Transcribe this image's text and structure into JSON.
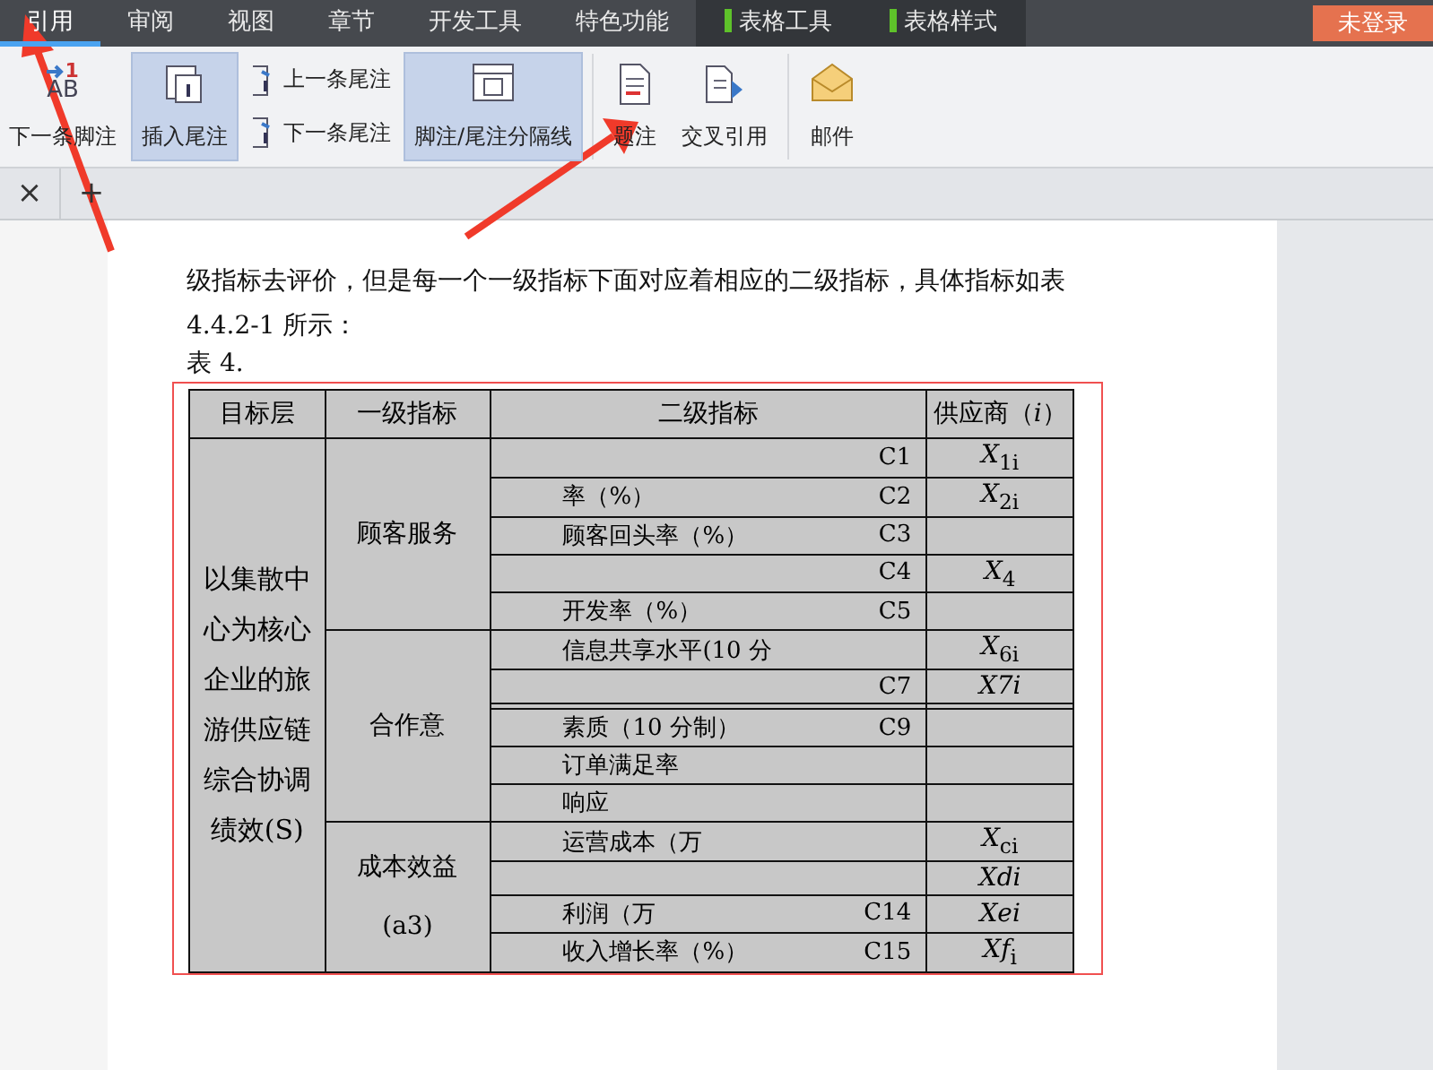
{
  "menu_tabs": [
    {
      "label": "引用",
      "selected": true,
      "kind": "normal"
    },
    {
      "label": "审阅",
      "selected": false,
      "kind": "normal"
    },
    {
      "label": "视图",
      "selected": false,
      "kind": "normal"
    },
    {
      "label": "章节",
      "selected": false,
      "kind": "normal"
    },
    {
      "label": "开发工具",
      "selected": false,
      "kind": "normal"
    },
    {
      "label": "特色功能",
      "selected": false,
      "kind": "normal"
    },
    {
      "label": "表格工具",
      "selected": false,
      "kind": "context"
    },
    {
      "label": "表格样式",
      "selected": false,
      "kind": "context"
    }
  ],
  "login_button": "未登录",
  "ribbon": [
    {
      "label": "下一条脚注",
      "kind": "large",
      "highlighted": false,
      "icon_text": {
        "badge": "1",
        "main": "AB"
      }
    },
    {
      "label": "插入尾注",
      "kind": "large",
      "highlighted": true
    },
    {
      "label": "上一条尾注",
      "kind": "small",
      "highlighted": false
    },
    {
      "label": "下一条尾注",
      "kind": "small",
      "highlighted": false
    },
    {
      "label": "脚注/尾注分隔线",
      "kind": "large",
      "highlighted": true
    },
    {
      "label": "题注",
      "kind": "large",
      "highlighted": false
    },
    {
      "label": "交叉引用",
      "kind": "large",
      "highlighted": false
    },
    {
      "label": "邮件",
      "kind": "large",
      "highlighted": false
    }
  ],
  "doc_tabs": {
    "close": "×",
    "add": "+"
  },
  "document": {
    "lines": [
      "级指标去评价，但是每一个一级指标下面对应着相应的二级指标，具体指标如表",
      "4.4.2-1 所示："
    ],
    "caption": "表 4."
  },
  "table": {
    "columns": [
      "目标层",
      "一级指标",
      "二级指标",
      "供应商（*i*）"
    ],
    "goal": "以集散中心为核心企业的旅游供应链综合协调绩效(S)",
    "groups": [
      {
        "name": "顾客服务",
        "rows": [
          {
            "indicator": "",
            "code": "C1",
            "supplier": "*X*$_{1i}$"
          },
          {
            "indicator": "率（%）",
            "code": "C2",
            "supplier": "*X*$_{2i}$"
          },
          {
            "indicator": "顾客回头率（%）",
            "code": "C3",
            "supplier": ""
          },
          {
            "indicator": "",
            "code": "C4",
            "supplier": "*X*$_{4}$"
          },
          {
            "indicator": "开发率（%）",
            "code": "C5",
            "supplier": ""
          }
        ]
      },
      {
        "name": "合作意",
        "rows": [
          {
            "indicator": "信息共享水平(10 分",
            "code": "",
            "supplier": "*X*$_{6i}$"
          },
          {
            "indicator": "",
            "code": "C7",
            "supplier": "*X7i*"
          },
          {
            "indicator": "",
            "code": "",
            "supplier": ""
          },
          {
            "indicator": "素质（10 分制）",
            "code": "C9",
            "supplier": ""
          },
          {
            "indicator": "订单满足率",
            "code": "",
            "supplier": ""
          },
          {
            "indicator": "响应",
            "code": "",
            "supplier": ""
          }
        ]
      },
      {
        "name": "成本效益",
        "sub": "(a3)",
        "rows": [
          {
            "indicator": "运营成本（万",
            "code": "",
            "supplier": "*X*$_{ci}$"
          },
          {
            "indicator": "",
            "code": "",
            "supplier": "*Xdi*"
          },
          {
            "indicator": "利润（万",
            "code": "C14",
            "supplier": "*Xei*"
          },
          {
            "indicator": "收入增长率（%）",
            "code": "C15",
            "supplier": "*Xf*$_{i}$"
          }
        ]
      }
    ]
  }
}
